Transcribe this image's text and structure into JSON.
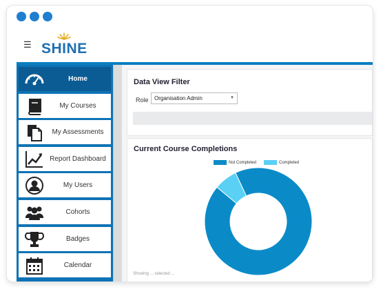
{
  "app": {
    "logo_text": "SHINE",
    "menu_icon": "hamburger-icon",
    "accent_color": "#0b7fc0",
    "window_dot_color": "#1e7fd1"
  },
  "sidebar": {
    "items": [
      {
        "label": "Home",
        "icon": "speedometer-icon",
        "active": true
      },
      {
        "label": "My Courses",
        "icon": "book-icon",
        "active": false
      },
      {
        "label": "My Assessments",
        "icon": "documents-icon",
        "active": false
      },
      {
        "label": "Report Dashboard",
        "icon": "line-chart-icon",
        "active": false
      },
      {
        "label": "My Users",
        "icon": "user-icon",
        "active": false
      },
      {
        "label": "Cohorts",
        "icon": "group-icon",
        "active": false
      },
      {
        "label": "Badges",
        "icon": "trophy-icon",
        "active": false
      },
      {
        "label": "Calendar",
        "icon": "calendar-icon",
        "active": false
      }
    ]
  },
  "filter": {
    "title": "Data View Filter",
    "role_label": "Role",
    "role_value": "Organisation Admin"
  },
  "completions": {
    "title": "Current Course Completions",
    "footnote": "Showing ... selected ..."
  },
  "chart_data": {
    "type": "pie",
    "variant": "donut",
    "title": "Current Course Completions",
    "categories": [
      "Not Completed",
      "Completed"
    ],
    "values": [
      93,
      7
    ],
    "colors": [
      "#0a8bc8",
      "#5bd0f5"
    ],
    "legend": "top"
  }
}
